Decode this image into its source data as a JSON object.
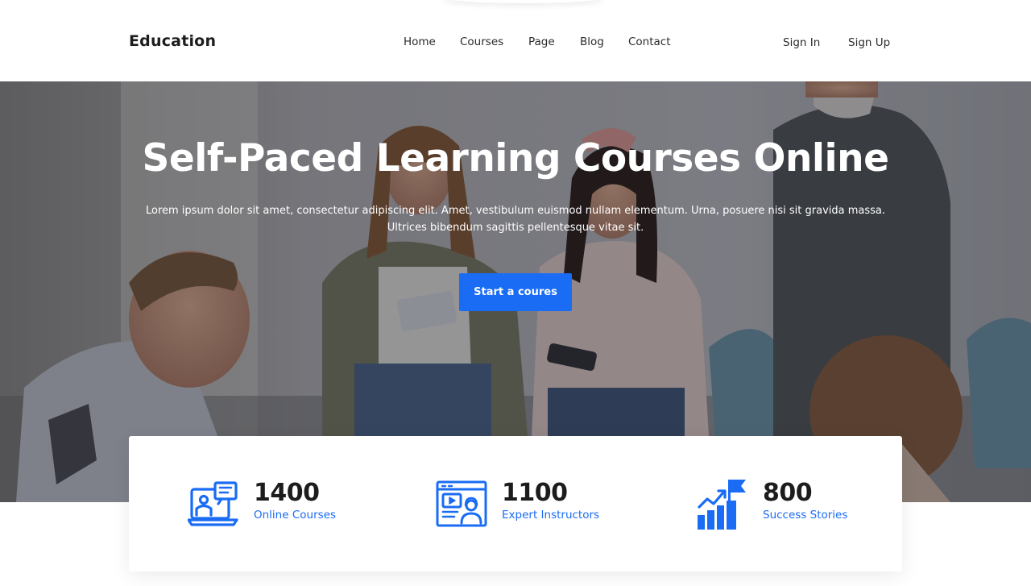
{
  "header": {
    "logo": "Education",
    "nav": [
      "Home",
      "Courses",
      "Page",
      "Blog",
      "Contact"
    ],
    "sign_in": "Sign In",
    "sign_up": "Sign Up"
  },
  "hero": {
    "title": "Self-Paced Learning Courses Online",
    "text": "Lorem ipsum dolor sit amet, consectetur adipiscing elit. Amet, vestibulum euismod nullam elementum. Urna, posuere nisi sit gravida massa. Ultrices bibendum sagittis pellentesque vitae sit.",
    "cta_label": "Start a coures"
  },
  "stats": [
    {
      "value": "1400",
      "label": "Online Courses",
      "icon": "online-courses-icon"
    },
    {
      "value": "1100",
      "label": "Expert Instructors",
      "icon": "expert-instructors-icon"
    },
    {
      "value": "800",
      "label": "Success Stories",
      "icon": "success-stories-icon"
    }
  ],
  "colors": {
    "accent": "#1a6cf5",
    "text_dark": "#1d1d1d",
    "hero_overlay": "#19191e"
  }
}
